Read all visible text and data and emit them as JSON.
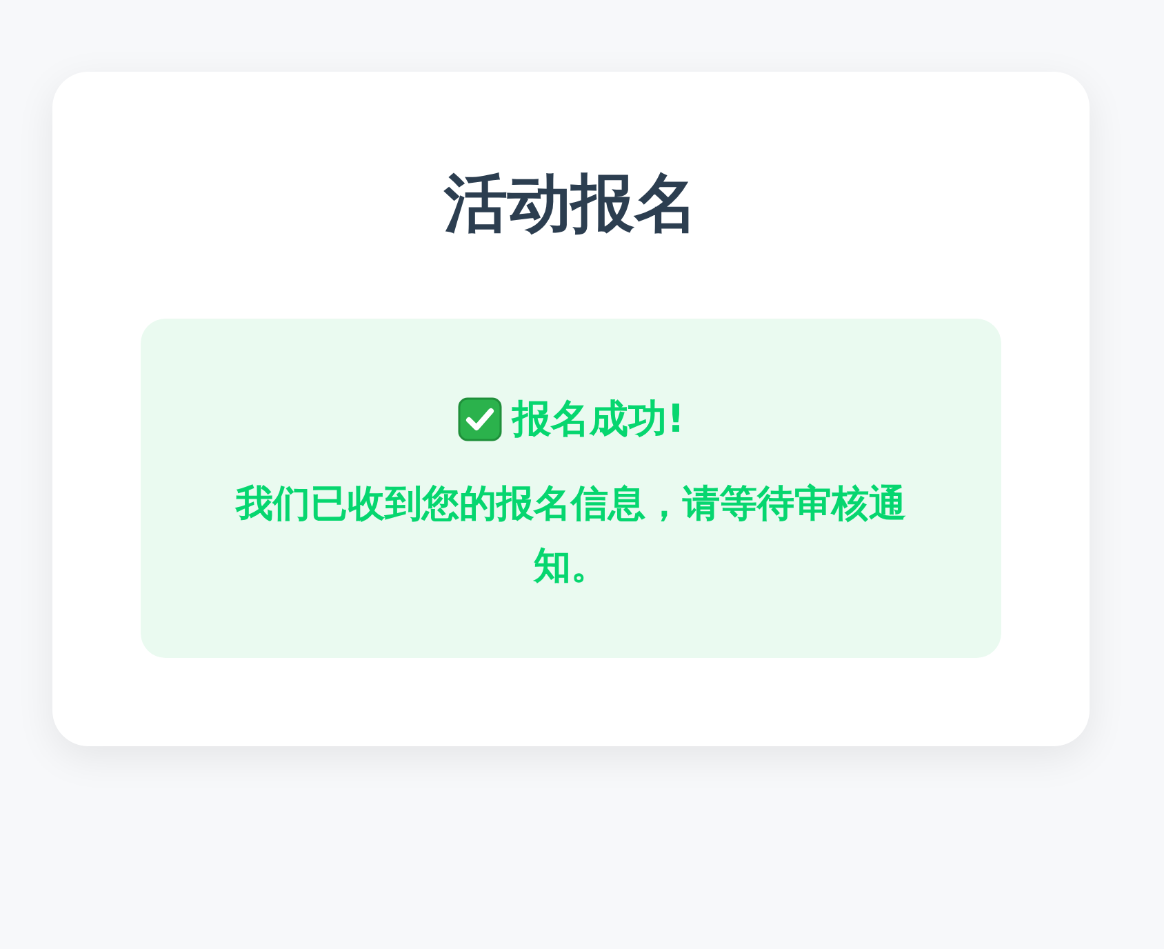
{
  "card": {
    "title": "活动报名",
    "result": {
      "kind": "success",
      "heading": "报名成功!",
      "message": "我们已收到您的报名信息，请等待审核通知。"
    }
  }
}
